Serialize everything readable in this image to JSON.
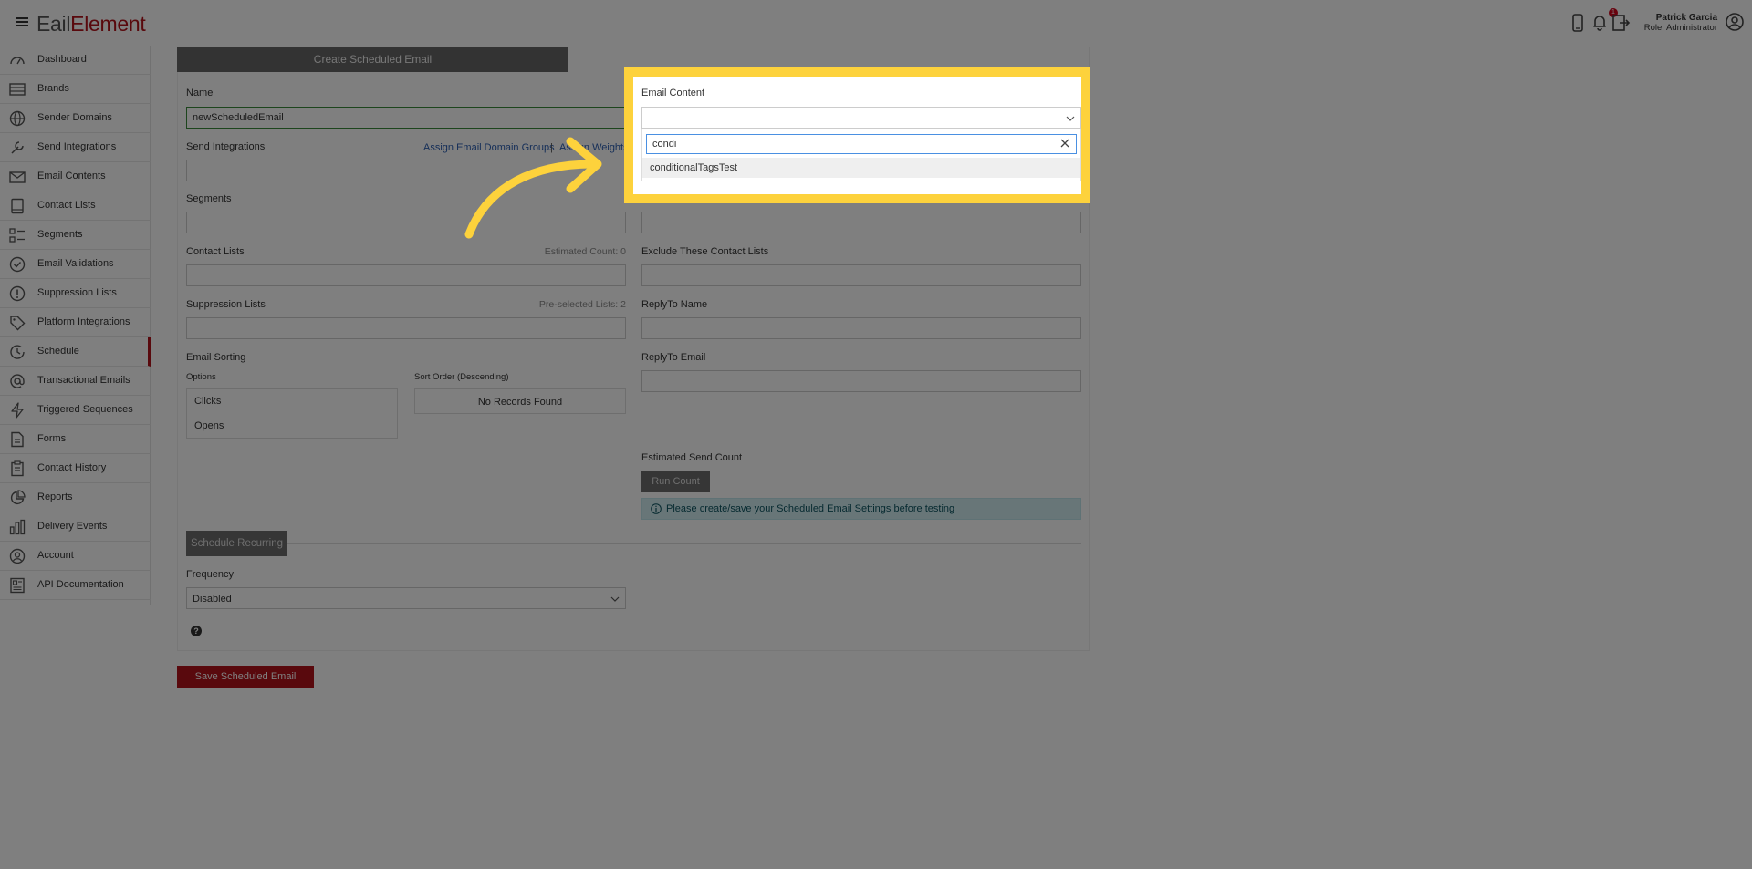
{
  "app": {
    "logo_first": "E",
    "logo_mid": "ail",
    "logo_last": "Element",
    "notification_count": "1",
    "user_name": "Patrick Garcia",
    "user_role": "Role: Administrator"
  },
  "sidebar": {
    "items": [
      {
        "label": "Dashboard",
        "icon": "gauge-icon"
      },
      {
        "label": "Brands",
        "icon": "brands-icon"
      },
      {
        "label": "Sender Domains",
        "icon": "globe-icon"
      },
      {
        "label": "Send Integrations",
        "icon": "wrench-icon"
      },
      {
        "label": "Email Contents",
        "icon": "envelope-icon"
      },
      {
        "label": "Contact Lists",
        "icon": "book-icon"
      },
      {
        "label": "Segments",
        "icon": "segments-icon"
      },
      {
        "label": "Email Validations",
        "icon": "check-circle-icon"
      },
      {
        "label": "Suppression Lists",
        "icon": "alert-circle-icon"
      },
      {
        "label": "Platform Integrations",
        "icon": "tag-icon"
      },
      {
        "label": "Schedule",
        "icon": "clock-icon"
      },
      {
        "label": "Transactional Emails",
        "icon": "at-icon"
      },
      {
        "label": "Triggered Sequences",
        "icon": "bolt-icon"
      },
      {
        "label": "Forms",
        "icon": "form-icon"
      },
      {
        "label": "Contact History",
        "icon": "clipboard-icon"
      },
      {
        "label": "Reports",
        "icon": "pie-chart-icon"
      },
      {
        "label": "Delivery Events",
        "icon": "bar-chart-icon"
      },
      {
        "label": "Account",
        "icon": "user-circle-icon"
      },
      {
        "label": "API Documentation",
        "icon": "document-icon"
      }
    ],
    "active_index": 10
  },
  "form": {
    "tab_title": "Create Scheduled Email",
    "name_label": "Name",
    "name_value": "newScheduledEmail",
    "send_integrations_label": "Send Integrations",
    "assign_domain_groups": "Assign Email Domain Groups",
    "link_separator": "|",
    "assign_weights": "Assign Weights",
    "segments_label": "Segments",
    "contact_lists_label": "Contact Lists",
    "estimated_count": "Estimated Count: 0",
    "exclude_label": "Exclude These Contact Lists",
    "suppression_label": "Suppression Lists",
    "preselected": "Pre-selected Lists: 2",
    "replyto_name_label": "ReplyTo Name",
    "replyto_email_label": "ReplyTo Email",
    "email_sorting_label": "Email Sorting",
    "options_label": "Options",
    "options": [
      "Clicks",
      "Opens"
    ],
    "sort_order_label": "Sort Order (Descending)",
    "no_records": "No Records Found",
    "estimated_send_label": "Estimated Send Count",
    "run_count": "Run Count",
    "info_text": "Please create/save your Scheduled Email Settings before testing",
    "schedule_recurring": "Schedule Recurring",
    "frequency_label": "Frequency",
    "frequency_value": "Disabled",
    "help_glyph": "?",
    "save_button": "Save Scheduled Email"
  },
  "popover": {
    "label": "Email Content",
    "search_value": "condi",
    "option": "conditionalTagsTest"
  },
  "colors": {
    "brand_red": "#b3131b",
    "highlight_yellow": "#fdd23c",
    "info_bg": "#d1ecf1"
  }
}
